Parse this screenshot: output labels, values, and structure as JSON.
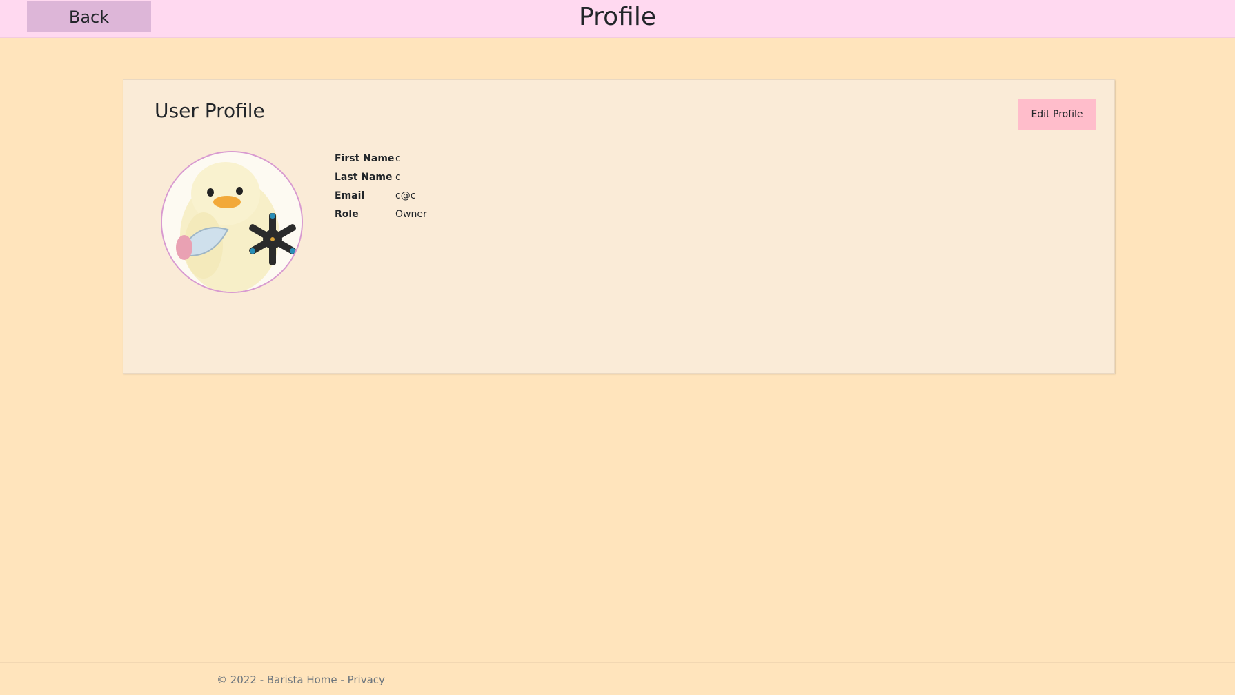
{
  "header": {
    "back_label": "Back",
    "title": "Profile"
  },
  "card": {
    "title": "User Profile",
    "edit_label": "Edit Profile",
    "fields": [
      {
        "label": "First Name",
        "value": "c"
      },
      {
        "label": "Last Name",
        "value": "c"
      },
      {
        "label": "Email",
        "value": "c@c"
      },
      {
        "label": "Role",
        "value": "Owner"
      }
    ]
  },
  "footer": {
    "copyright": "© 2022 - Barista Home - ",
    "privacy_label": "Privacy"
  },
  "colors": {
    "header_bg": "#ffd9f0",
    "page_bg": "#ffe4bc",
    "card_bg": "#faebd7",
    "edit_button": "#ffbdcb",
    "back_button": "#ddb6d8"
  }
}
